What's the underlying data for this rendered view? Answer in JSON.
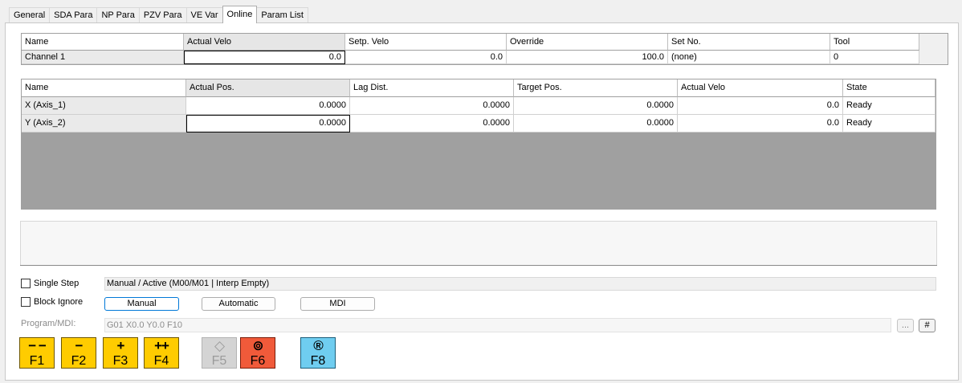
{
  "tabs": [
    "General",
    "SDA Para",
    "NP Para",
    "PZV Para",
    "VE Var",
    "Online",
    "Param List"
  ],
  "active_tab": "Online",
  "channel_table": {
    "columns": [
      "Name",
      "Actual Velo",
      "Setp. Velo",
      "Override",
      "Set No.",
      "Tool"
    ],
    "rows": [
      [
        "Channel 1",
        "0.0",
        "0.0",
        "100.0",
        "(none)",
        "0"
      ]
    ]
  },
  "axis_table": {
    "columns": [
      "Name",
      "Actual Pos.",
      "Lag Dist.",
      "Target Pos.",
      "Actual Velo",
      "State"
    ],
    "rows": [
      [
        "X (Axis_1)",
        "0.0000",
        "0.0000",
        "0.0000",
        "0.0",
        "Ready"
      ],
      [
        "Y (Axis_2)",
        "0.0000",
        "0.0000",
        "0.0000",
        "0.0",
        "Ready"
      ]
    ]
  },
  "controls": {
    "single_step": "Single Step",
    "block_ignore": "Block Ignore",
    "status": "Manual / Active (M00/M01 | Interp Empty)",
    "mode_manual": "Manual",
    "mode_automatic": "Automatic",
    "mode_mdi": "MDI",
    "program_label": "Program/MDI:",
    "program_value": "G01 X0.0 Y0.0 F10",
    "browse_btn": "...",
    "hash_btn": "#"
  },
  "fkeys": [
    {
      "sym": "− −",
      "key": "F1",
      "color": "#ffcc00",
      "icon": "fast-backward-icon"
    },
    {
      "sym": "−",
      "key": "F2",
      "color": "#ffcc00",
      "icon": "backward-icon"
    },
    {
      "sym": "+",
      "key": "F3",
      "color": "#ffcc00",
      "icon": "forward-icon"
    },
    {
      "sym": "++",
      "key": "F4",
      "color": "#ffcc00",
      "icon": "fast-forward-icon"
    },
    {
      "sym": "◇",
      "key": "F5",
      "color": "#d4d4d4",
      "icon": "start-icon"
    },
    {
      "sym": "⊚",
      "key": "F6",
      "color": "#f05a3a",
      "icon": "stop-icon"
    },
    {
      "sym": "®",
      "key": "F8",
      "color": "#6fcdf0",
      "icon": "reset-icon"
    }
  ]
}
